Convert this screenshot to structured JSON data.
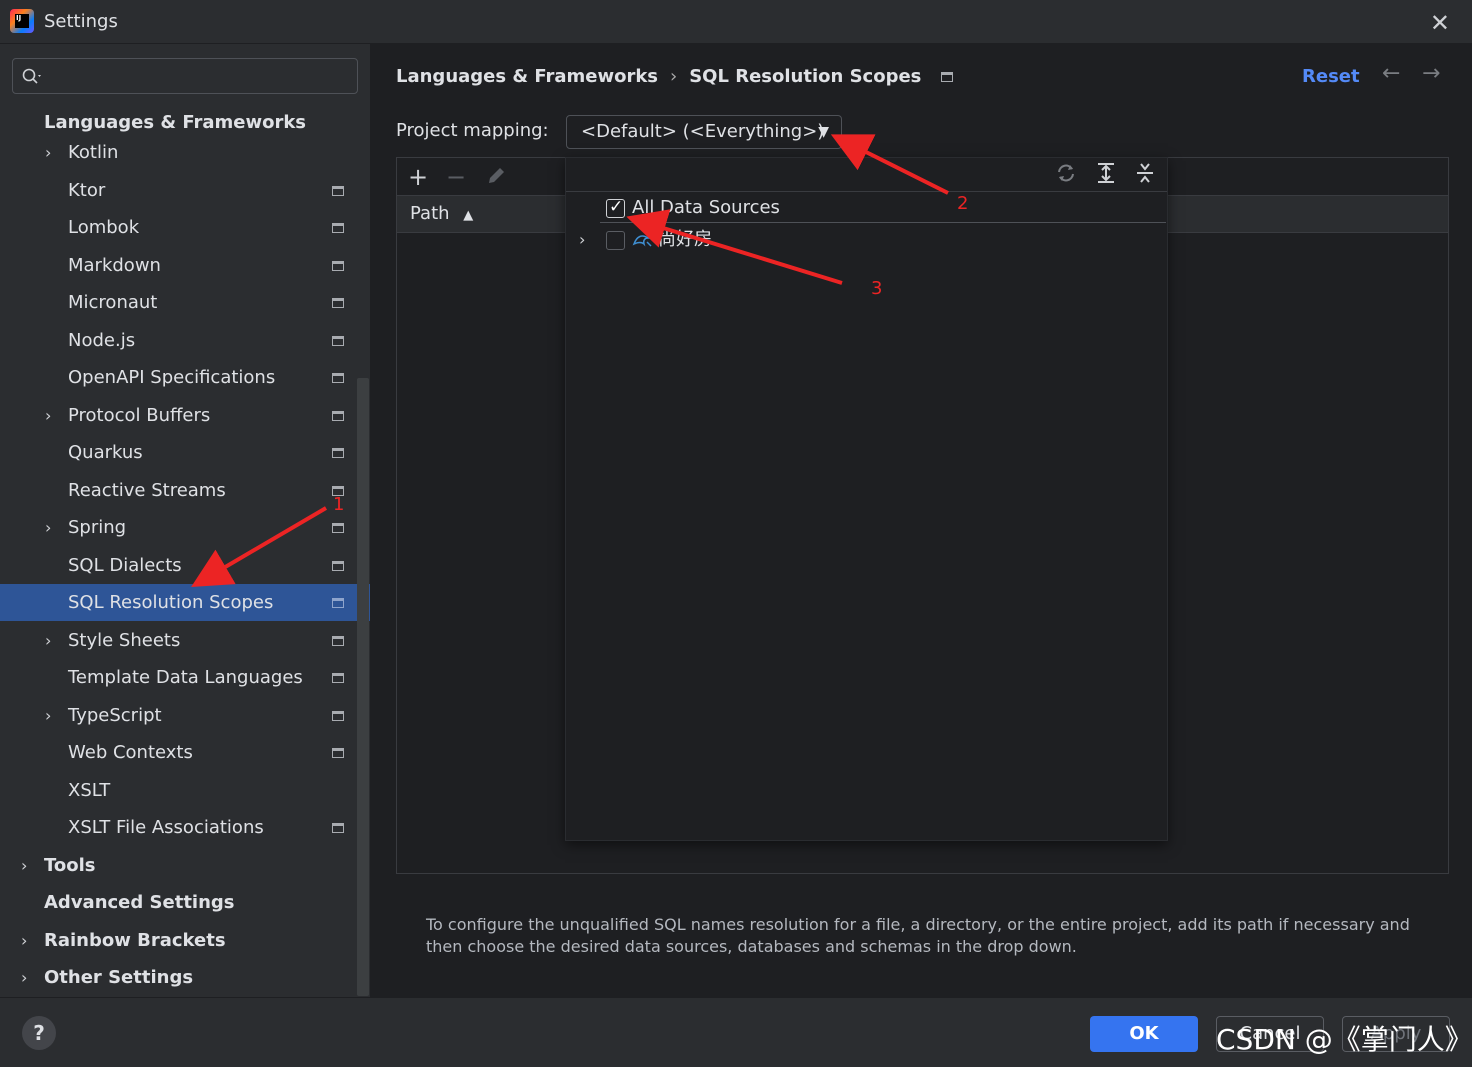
{
  "window": {
    "title": "Settings"
  },
  "search": {
    "placeholder": ""
  },
  "sidebar": {
    "heading": "Languages & Frameworks",
    "items": [
      {
        "label": "Kotlin",
        "expandable": true,
        "project_icon": false
      },
      {
        "label": "Ktor",
        "expandable": false,
        "project_icon": true
      },
      {
        "label": "Lombok",
        "expandable": false,
        "project_icon": true
      },
      {
        "label": "Markdown",
        "expandable": false,
        "project_icon": true
      },
      {
        "label": "Micronaut",
        "expandable": false,
        "project_icon": true
      },
      {
        "label": "Node.js",
        "expandable": false,
        "project_icon": true
      },
      {
        "label": "OpenAPI Specifications",
        "expandable": false,
        "project_icon": true
      },
      {
        "label": "Protocol Buffers",
        "expandable": true,
        "project_icon": true
      },
      {
        "label": "Quarkus",
        "expandable": false,
        "project_icon": true
      },
      {
        "label": "Reactive Streams",
        "expandable": false,
        "project_icon": true
      },
      {
        "label": "Spring",
        "expandable": true,
        "project_icon": true
      },
      {
        "label": "SQL Dialects",
        "expandable": false,
        "project_icon": true
      },
      {
        "label": "SQL Resolution Scopes",
        "expandable": false,
        "project_icon": true,
        "selected": true
      },
      {
        "label": "Style Sheets",
        "expandable": true,
        "project_icon": true
      },
      {
        "label": "Template Data Languages",
        "expandable": false,
        "project_icon": true
      },
      {
        "label": "TypeScript",
        "expandable": true,
        "project_icon": true
      },
      {
        "label": "Web Contexts",
        "expandable": false,
        "project_icon": true
      },
      {
        "label": "XSLT",
        "expandable": false,
        "project_icon": false
      },
      {
        "label": "XSLT File Associations",
        "expandable": false,
        "project_icon": true
      }
    ],
    "top_items": [
      {
        "label": "Tools",
        "expandable": true
      },
      {
        "label": "Advanced Settings",
        "expandable": false
      },
      {
        "label": "Rainbow Brackets",
        "expandable": true
      },
      {
        "label": "Other Settings",
        "expandable": true
      }
    ]
  },
  "breadcrumb": {
    "parent": "Languages & Frameworks",
    "separator": "›",
    "current": "SQL Resolution Scopes"
  },
  "header_actions": {
    "reset": "Reset",
    "back_icon": "arrow-left-icon",
    "forward_icon": "arrow-right-icon"
  },
  "project_mapping": {
    "label": "Project mapping:",
    "value": "<Default> (<Everything>)"
  },
  "table": {
    "toolbar": {
      "add": "+",
      "remove": "−",
      "edit_icon": "pencil-icon"
    },
    "columns": [
      {
        "label": "Path",
        "sort": "asc"
      }
    ]
  },
  "popup": {
    "toolbar_icons": [
      "refresh-icon",
      "expand-all-icon",
      "collapse-all-icon"
    ],
    "rows": [
      {
        "label": "All Data Sources",
        "checked": true
      },
      {
        "label": "尚好房",
        "checked": false,
        "expandable": true
      }
    ]
  },
  "hint": "To configure the unqualified SQL names resolution for a file, a directory, or the entire project, add its path if necessary and then choose the desired data sources, databases and schemas in the drop down.",
  "footer": {
    "help": "?",
    "ok": "OK",
    "cancel": "Cancel",
    "apply": "Apply"
  },
  "annotations": [
    "1",
    "2",
    "3"
  ],
  "watermark": "CSDN @《掌门人》",
  "colors": {
    "accent": "#3574f0",
    "selection": "#2e5597",
    "link": "#548af7",
    "annotation": "#ec2424"
  }
}
